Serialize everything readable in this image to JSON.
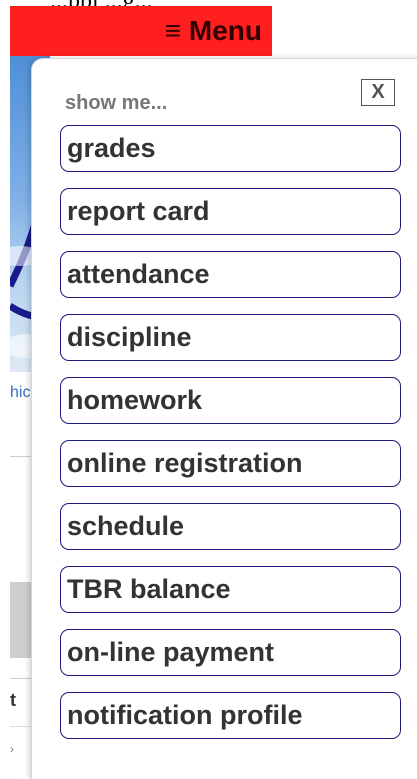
{
  "page_header": {
    "partial_text": "...ppi ...g..."
  },
  "menu_bar": {
    "label": "≡ Menu"
  },
  "background": {
    "link_fragment": "hic",
    "text_fragment": "t",
    "arrow_fragment": "›"
  },
  "panel": {
    "title": "show me...",
    "close_label": "X",
    "items": [
      {
        "label": "grades"
      },
      {
        "label": "report card"
      },
      {
        "label": "attendance"
      },
      {
        "label": "discipline"
      },
      {
        "label": "homework"
      },
      {
        "label": "online registration"
      },
      {
        "label": "schedule"
      },
      {
        "label": "TBR balance"
      },
      {
        "label": "on-line payment"
      },
      {
        "label": "notification profile"
      }
    ]
  },
  "colors": {
    "menu_bar_bg": "#ff1f1f",
    "menu_text": "#330000",
    "item_border": "#1c1c80",
    "item_text": "#333333",
    "title_text": "#777777"
  }
}
